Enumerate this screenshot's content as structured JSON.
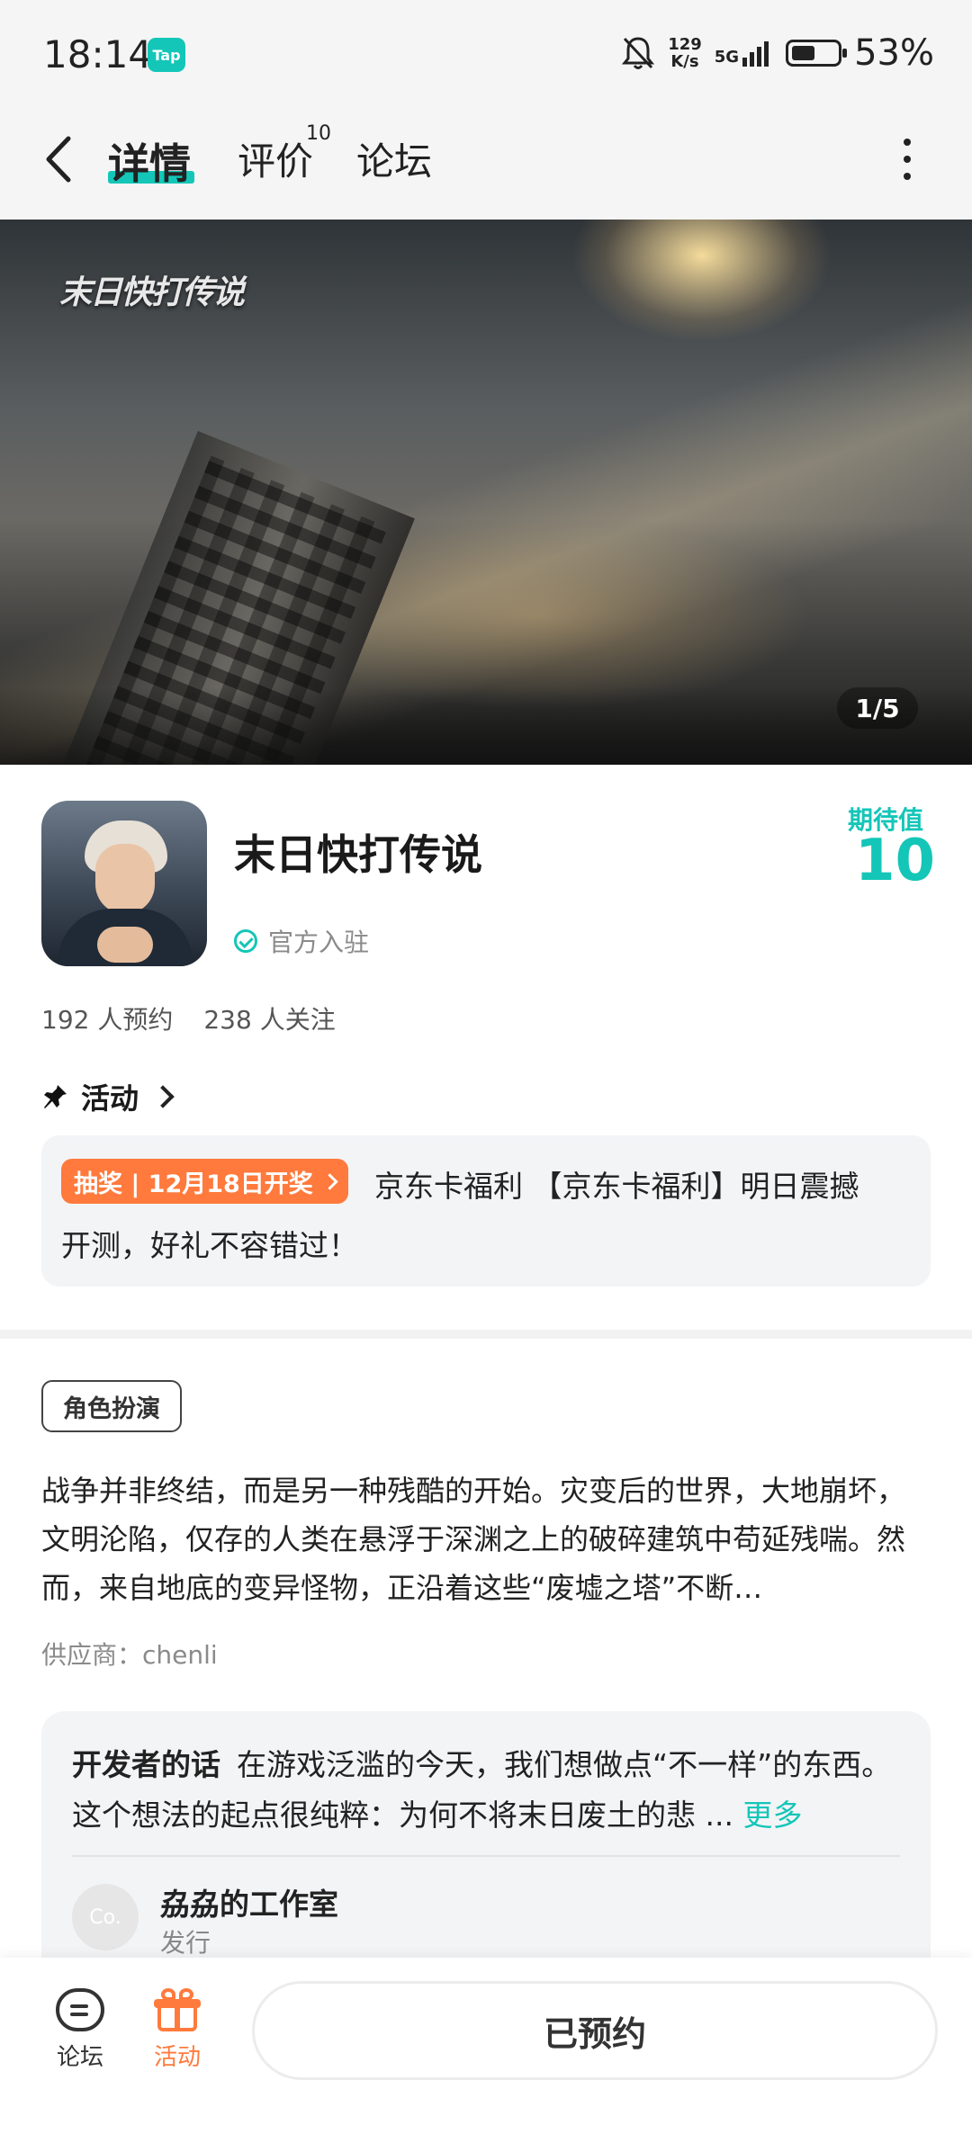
{
  "status_bar": {
    "time": "18:14",
    "app_badge": "Tap",
    "net_speed_value": "129",
    "net_speed_unit": "K/s",
    "network": "5G",
    "battery_percent": "53%",
    "battery_level": 0.53
  },
  "nav": {
    "tabs": [
      {
        "label": "详情",
        "active": true
      },
      {
        "label": "评价",
        "count": "10"
      },
      {
        "label": "论坛"
      }
    ]
  },
  "banner": {
    "logo_text": "末日快打传说",
    "page_indicator": "1/5"
  },
  "game": {
    "title": "末日快打传说",
    "official_label": "官方入驻",
    "expectation_label": "期待值",
    "expectation_value": "10",
    "reservations": "192 人预约",
    "followers": "238 人关注"
  },
  "activity": {
    "heading": "活动",
    "badge": "抽奖 | 12月18日开奖",
    "text_line1": "京东卡福利 【京东卡福利】明日震撼",
    "text_line2": "开测，好礼不容错过！"
  },
  "description": {
    "tag": "角色扮演",
    "text": "战争并非终结，而是另一种残酷的开始。灾变后的世界，大地崩坏，文明沦陷，仅存的人类在悬浮于深渊之上的破碎建筑中苟延残喘。然而，来自地底的变异怪物，正沿着这些“废墟之塔”不断…",
    "provider": "供应商：chenli"
  },
  "developer": {
    "label": "开发者的话",
    "text": "在游戏泛滥的今天，我们想做点“不一样”的东西。这个想法的起点很纯粹：为何不将末日废土的悲 ...",
    "more": "更多",
    "avatar_text": "Co.",
    "studio_name": "劦劦的工作室",
    "studio_role": "发行"
  },
  "bottom_bar": {
    "forum_label": "论坛",
    "activity_label": "活动",
    "reserve_button": "已预约"
  },
  "colors": {
    "accent": "#14c6b8",
    "orange": "#ff7a3c"
  }
}
